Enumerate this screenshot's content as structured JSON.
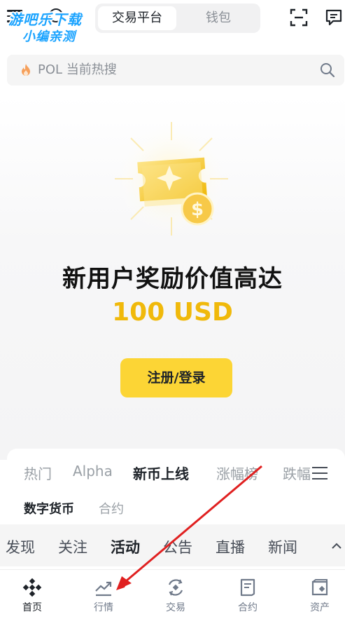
{
  "watermark": {
    "line1": "游吧乐下载",
    "line2": "小编亲测"
  },
  "header": {
    "tabs": [
      "交易平台",
      "钱包"
    ]
  },
  "search": {
    "hot_prefix": "POL",
    "hot_label": "当前热搜"
  },
  "promo": {
    "headline": "新用户奖励价值高达",
    "amount": "100 USD",
    "button": "注册/登录"
  },
  "market": {
    "tabs": [
      "热门",
      "Alpha",
      "新币上线",
      "涨幅榜",
      "跌幅"
    ],
    "active_tab": "新币上线",
    "subtabs": [
      "数字货币",
      "合约"
    ]
  },
  "feed": {
    "tabs": [
      "发现",
      "关注",
      "活动",
      "公告",
      "直播",
      "新闻"
    ],
    "active_tab": "活动"
  },
  "nav": {
    "items": [
      "首页",
      "行情",
      "交易",
      "合约",
      "资产"
    ],
    "active": "首页"
  },
  "colors": {
    "brand_yellow": "#fcd535",
    "amount_gold": "#f0b90b",
    "annotation_red": "#e02020"
  }
}
